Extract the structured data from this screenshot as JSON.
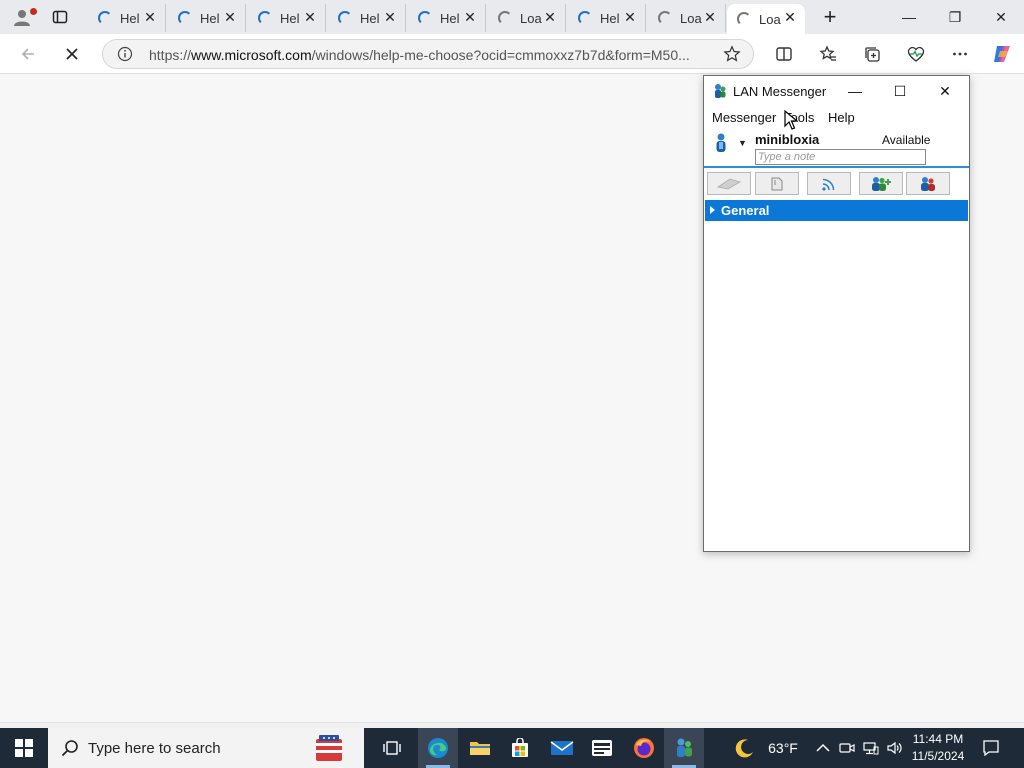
{
  "browser": {
    "tabs": [
      {
        "title": "Hel",
        "state": "loading"
      },
      {
        "title": "Hel",
        "state": "loading"
      },
      {
        "title": "Hel",
        "state": "loading"
      },
      {
        "title": "Hel",
        "state": "loading"
      },
      {
        "title": "Hel",
        "state": "loading"
      },
      {
        "title": "Loa",
        "state": "loading-gray"
      },
      {
        "title": "Hel",
        "state": "loading"
      },
      {
        "title": "Loa",
        "state": "loading-gray"
      },
      {
        "title": "Loa",
        "state": "loading-gray",
        "active": true
      }
    ],
    "tab_close_glyph": "✕",
    "new_tab_glyph": "+",
    "url_prefix": "https://",
    "url_host": "www.microsoft.com",
    "url_rest": "/windows/help-me-choose?ocid=cmmoxxz7b7d&form=M50...",
    "window_controls": {
      "minimize": "—",
      "restore": "❐",
      "close": "✕"
    }
  },
  "lan": {
    "title": "LAN Messenger",
    "menus": [
      "Messenger",
      "Tools",
      "Help"
    ],
    "username": "minibloxia",
    "status": "Available",
    "note_placeholder": "Type a note",
    "group_label": "General",
    "window_controls": {
      "minimize": "—",
      "maximize": "☐",
      "close": "✕"
    }
  },
  "taskbar": {
    "search_placeholder": "Type here to search",
    "weather": "63°F",
    "time": "11:44 PM",
    "date": "11/5/2024"
  },
  "colors": {
    "accent": "#0b77d6",
    "taskbar": "#1f2a38",
    "tabstrip": "#e9eaed"
  }
}
